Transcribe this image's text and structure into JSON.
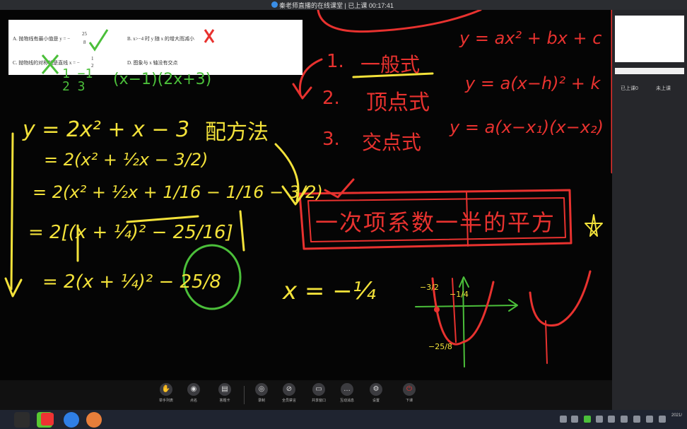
{
  "window": {
    "title": "秦老师直播的在线课堂 | 已上课 00:17:41"
  },
  "question": {
    "a_prefix": "A.  抛物线有最小值是 y = −",
    "a_num": "25",
    "a_den": "8",
    "b": "B.   x>−4 时 y 随 x 的增大而减小",
    "c_prefix": "C.  抛物线的对称轴是直线 x = −",
    "c_num": "1",
    "c_den": "2",
    "d": "D.  图象与 x 轴没有交点"
  },
  "board_notes": {
    "roots": "1  −1",
    "roots2": "2  3",
    "factor": "(x−1)(2x+3)",
    "eq": "y = 2x² + x − 3",
    "method": "配方法",
    "step1": "= 2(x² + ½x − 3/2)",
    "step2": "= 2(x² + ½x + 1/16 − 1/16 − 3/2)",
    "step3a": "= 2[(x + ¼)² − 25/16]",
    "step4": "= 2(x + ¼)² − 25/8",
    "axis": "x = −¼",
    "item1_num": "1.",
    "item1": "一般式",
    "formula1": "y = ax² + bx + c",
    "item2_num": "2.",
    "item2": "顶点式",
    "formula2": "y = a(x−h)² + k",
    "item3_num": "3.",
    "item3": "交点式",
    "formula3": "y = a(x−x₁)(x−x₂)",
    "boxed": "一次项系数一半的平方",
    "star": "✱",
    "graph_labels": [
      "−3/2",
      "−1/4",
      "−25/8"
    ]
  },
  "side_panel": {
    "attended": "已上课0",
    "not_attended": "未上课"
  },
  "toolbar": {
    "items": [
      {
        "label": "举手列表",
        "icon": "hand-icon"
      },
      {
        "label": "点名",
        "icon": "user-check-icon"
      },
      {
        "label": "答题卡",
        "icon": "card-icon"
      },
      {
        "label": "录制",
        "icon": "record-icon"
      },
      {
        "label": "全员禁言",
        "icon": "mute-icon"
      },
      {
        "label": "共享窗口",
        "icon": "screen-share-icon"
      },
      {
        "label": "互动消息",
        "icon": "chat-icon"
      },
      {
        "label": "设置",
        "icon": "gear-icon"
      },
      {
        "label": "下课",
        "icon": "power-icon"
      }
    ]
  },
  "taskbar": {
    "clock_time": "2021/",
    "clock_date": ""
  },
  "colors": {
    "red_ink": "#e8322f",
    "yellow_ink": "#f3e23a",
    "green_ink": "#4bbf3a"
  }
}
